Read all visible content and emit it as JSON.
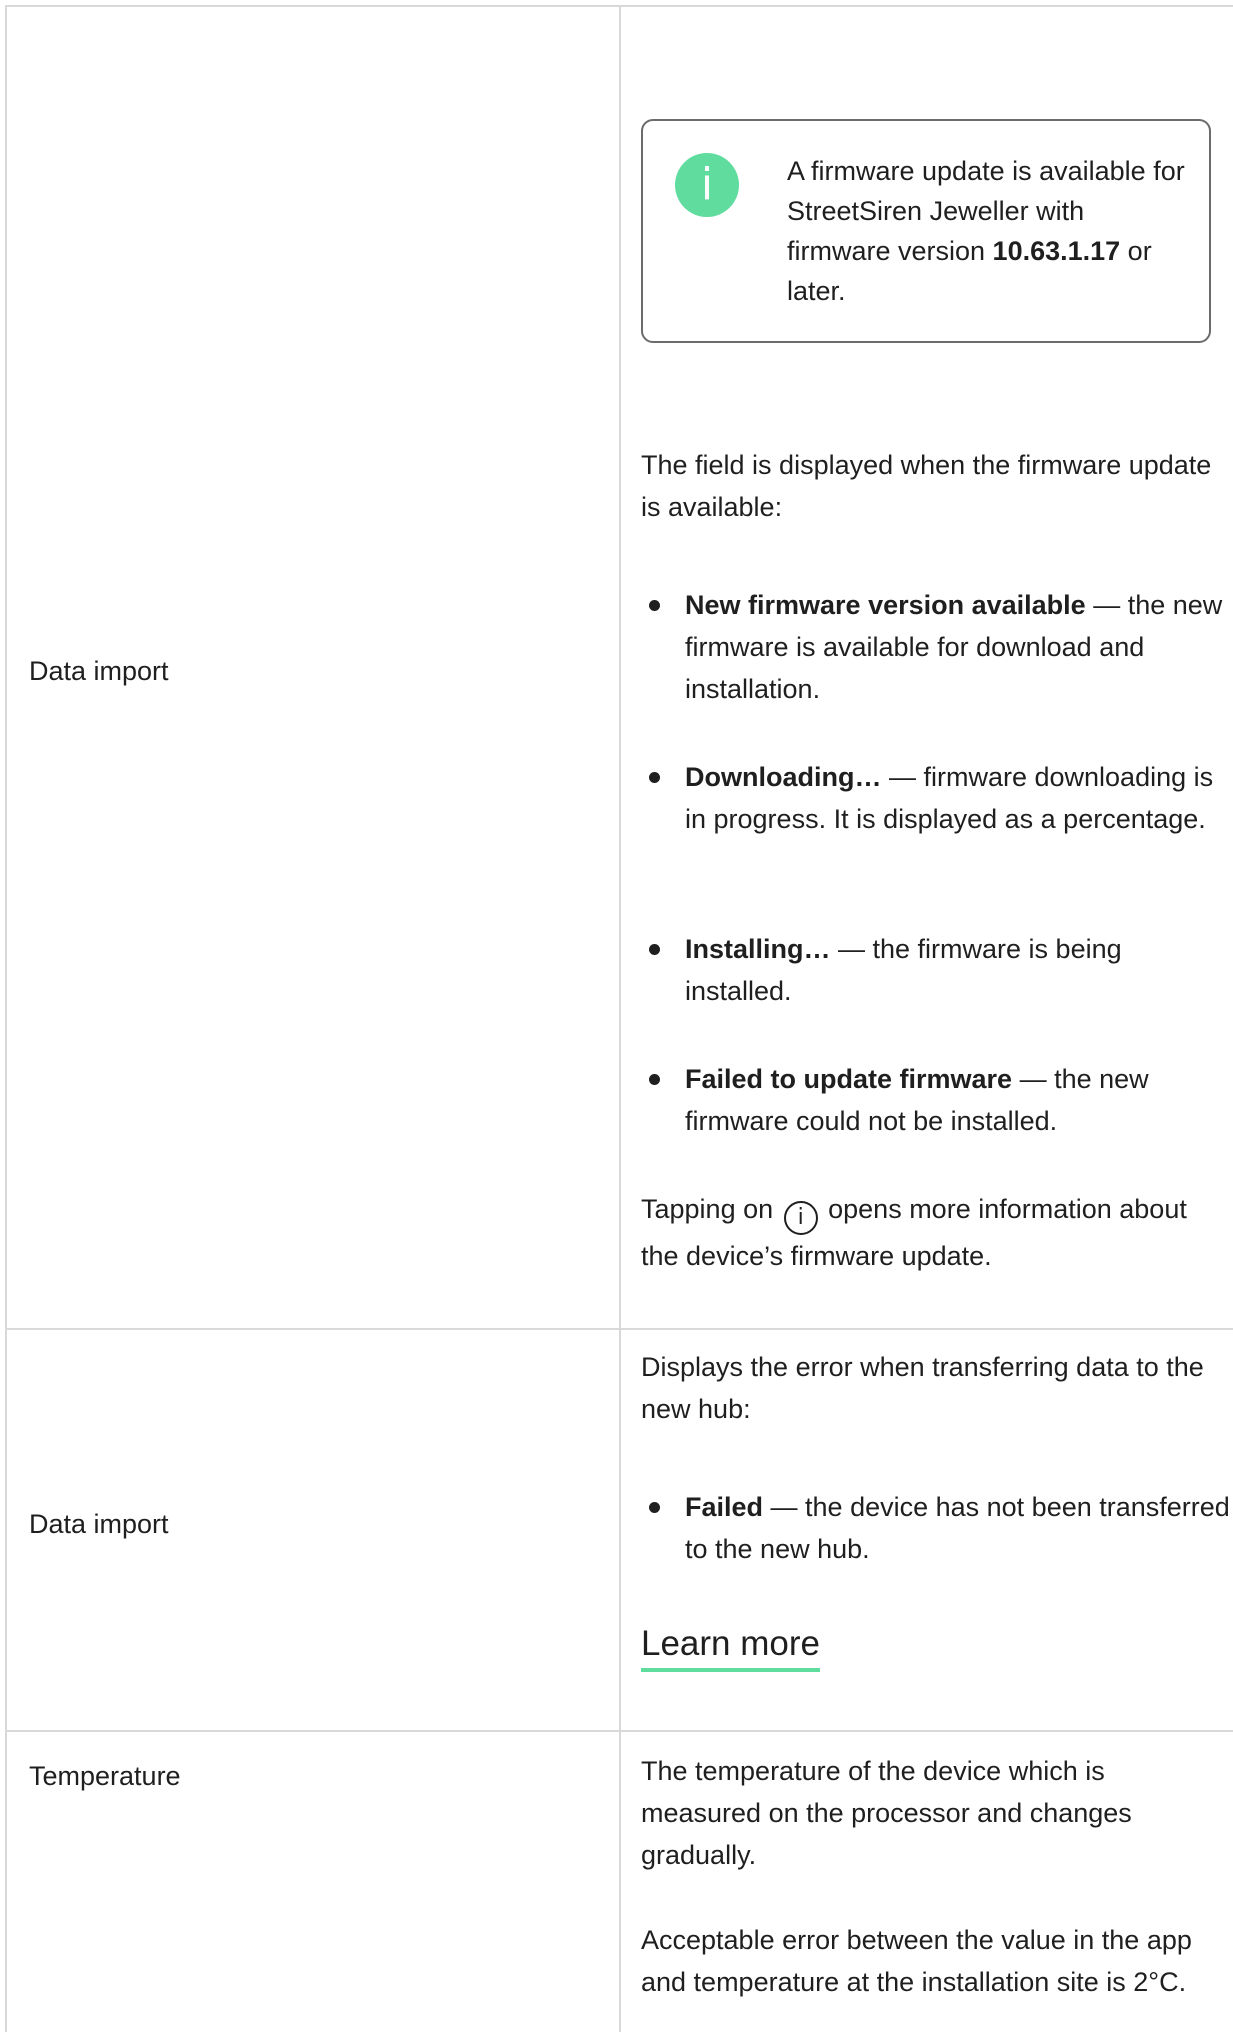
{
  "rows": [
    {
      "label": "Data import",
      "callout": {
        "icon": "info-icon",
        "text_before": "A firmware update is available for StreetSiren Jeweller with firmware version ",
        "version": "10.63.1.17",
        "text_after": " or later."
      },
      "intro": "The field is displayed when the firmware update is available:",
      "bullets": [
        {
          "term": "New firmware version available",
          "desc": " — the new firmware is available for download and installation."
        },
        {
          "term": "Downloading…",
          "desc": " — firmware downloading is in progress. It is displayed as a percentage."
        },
        {
          "term": "Installing…",
          "desc": " — the firmware is being installed."
        },
        {
          "term": "Failed to update firmware",
          "desc": " — the new firmware could not be installed."
        }
      ],
      "note_before": "Tapping on ",
      "note_icon": "i",
      "note_after": " opens more information about the device’s firmware update."
    },
    {
      "label": "Data import",
      "intro": "Displays the error when transferring data to the new hub:",
      "bullets": [
        {
          "term": "Failed",
          "desc": " — the device has not been transferred to the new hub."
        }
      ],
      "link": "Learn more"
    },
    {
      "label": "Temperature",
      "paragraphs": [
        "The temperature of the device which is measured on the processor and changes gradually.",
        "Acceptable error between the value in the app and temperature at the installation site is 2°C."
      ]
    }
  ],
  "colors": {
    "accent": "#5fdc9e",
    "border": "#d9d9d9",
    "text": "#1f1f1f"
  }
}
